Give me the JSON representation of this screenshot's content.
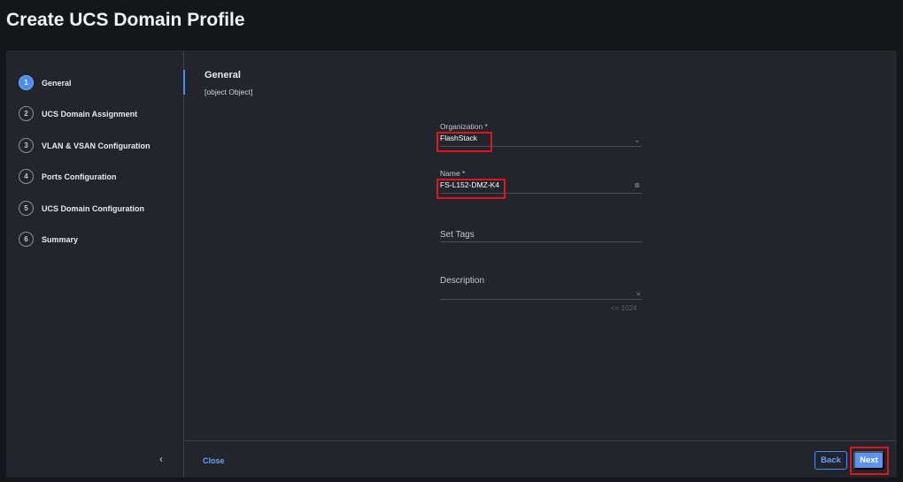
{
  "header": {
    "title": "Create UCS Domain Profile"
  },
  "steps": [
    {
      "num": "1",
      "label": "General"
    },
    {
      "num": "2",
      "label": "UCS Domain Assignment"
    },
    {
      "num": "3",
      "label": "VLAN & VSAN Configuration"
    },
    {
      "num": "4",
      "label": "Ports Configuration"
    },
    {
      "num": "5",
      "label": "UCS Domain Configuration"
    },
    {
      "num": "6",
      "label": "Summary"
    }
  ],
  "main": {
    "heading": "General",
    "description": {
      "placeholder": "Description",
      "counter": "<= 1024"
    },
    "organization": {
      "label": "Organization *",
      "value": "FlashStack"
    },
    "name": {
      "label": "Name *",
      "value": "FS-L152-DMZ-K4"
    },
    "tags": {
      "placeholder": "Set Tags"
    }
  },
  "footer": {
    "close": "Close",
    "back": "Back",
    "next": "Next"
  },
  "colors": {
    "accent": "#4d8df0",
    "highlight": "#e0141c"
  }
}
